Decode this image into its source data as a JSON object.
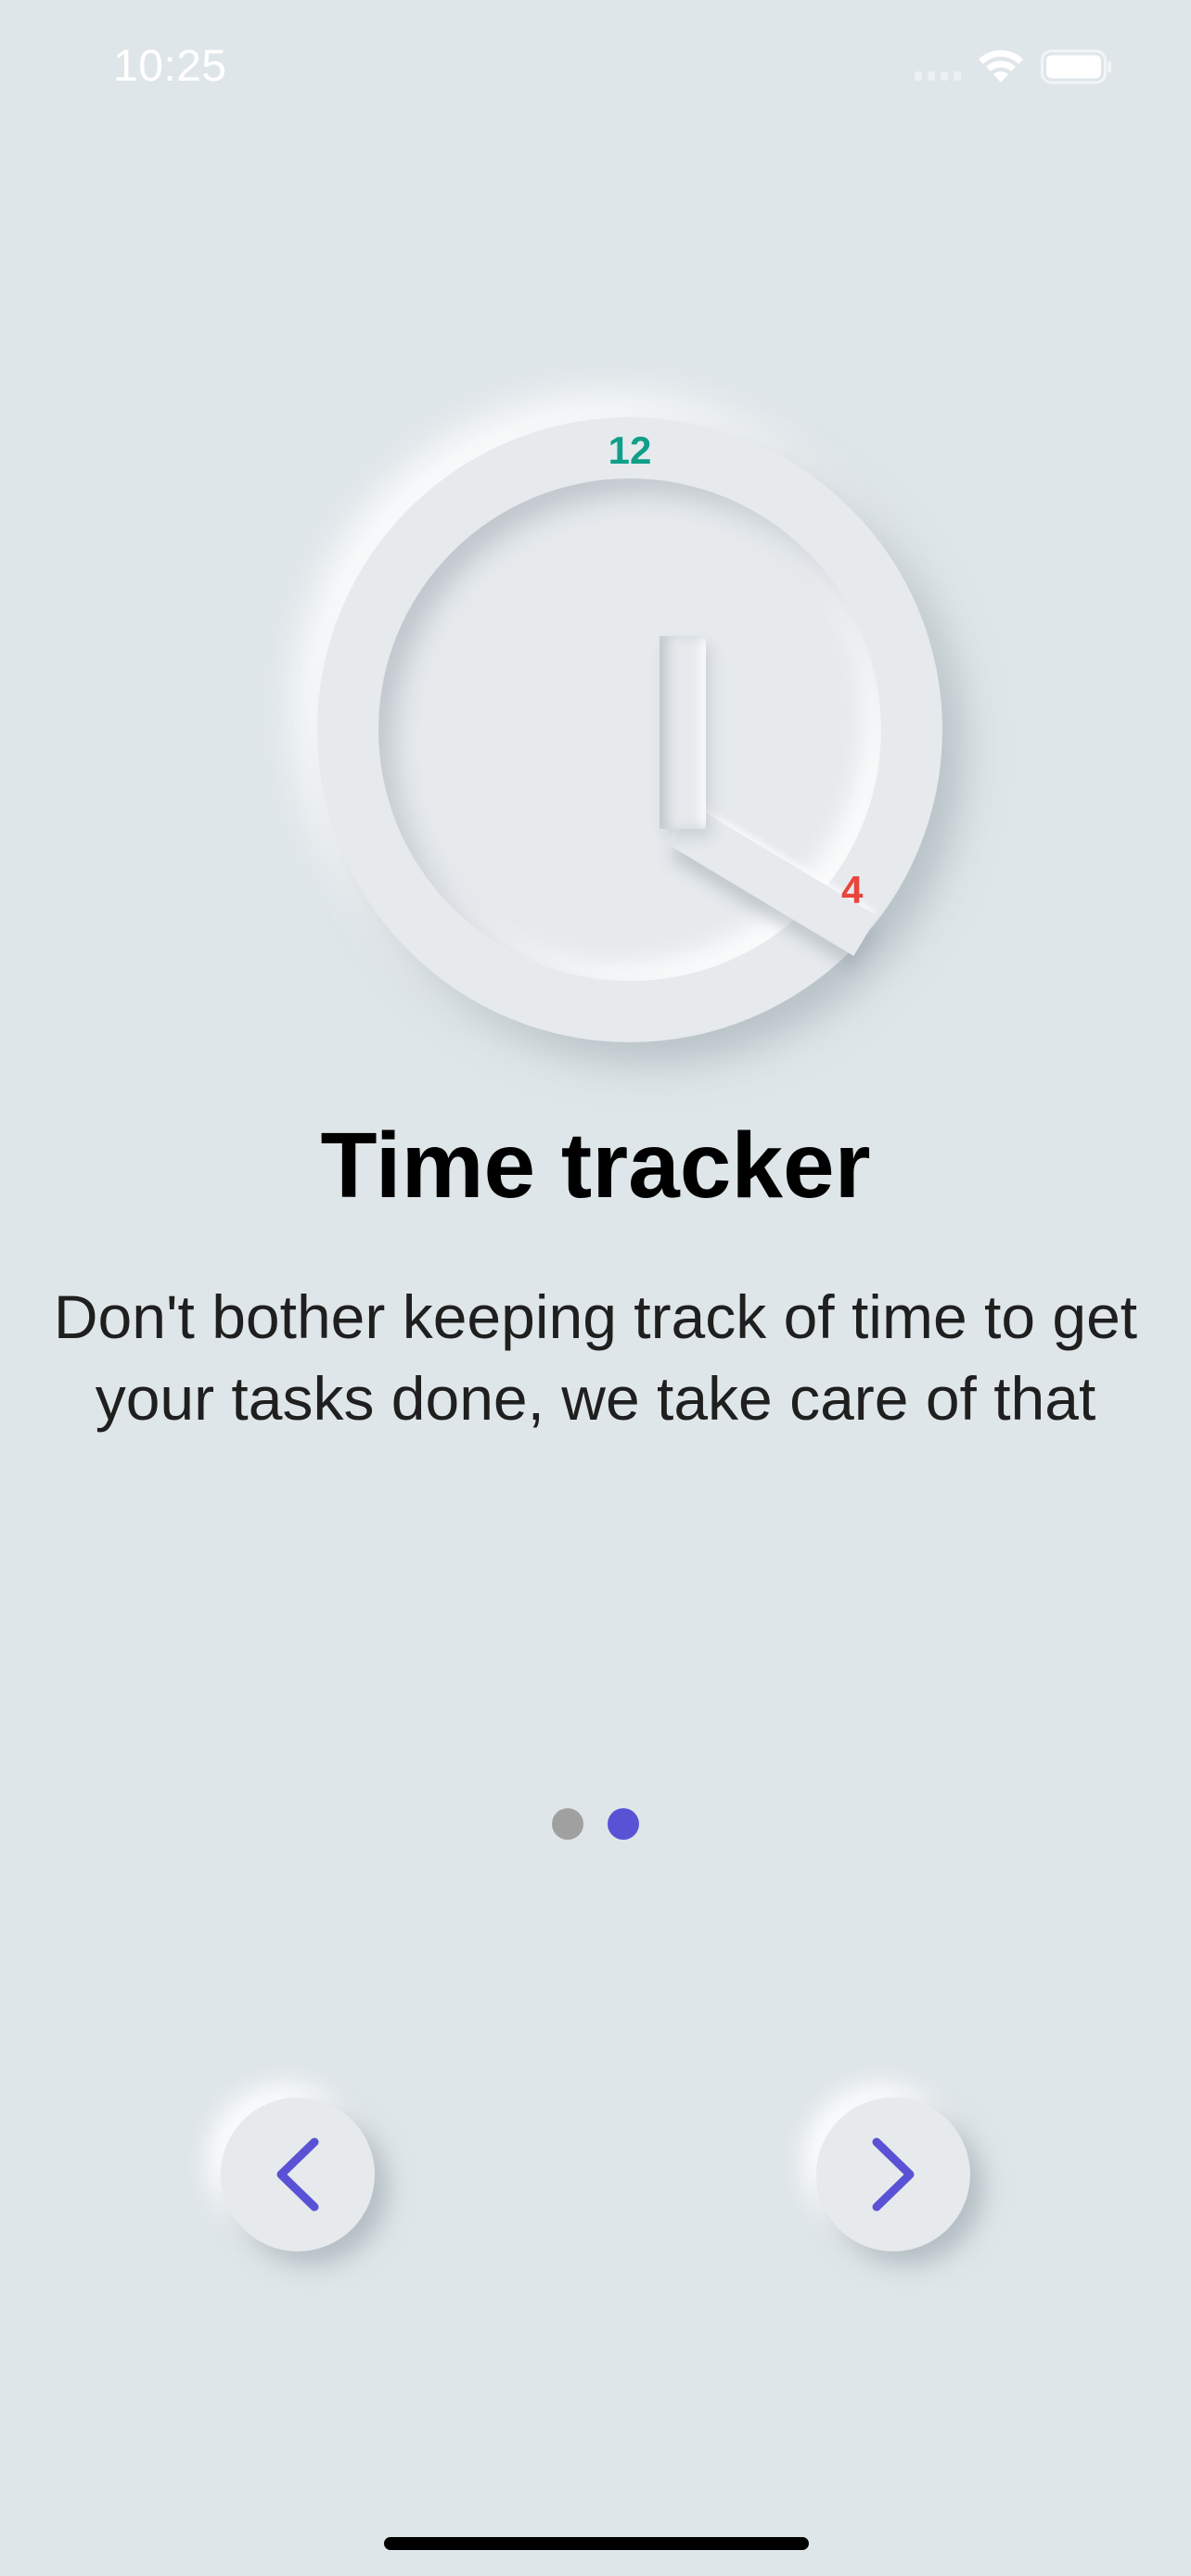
{
  "status_bar": {
    "time": "10:25"
  },
  "clock": {
    "number_top": "12",
    "number_side": "4",
    "color_top": "#0f9e8a",
    "color_side": "#e8453c"
  },
  "onboarding": {
    "title": "Time tracker",
    "description": "Don't bother keeping track of time to get your tasks done, we take care of that"
  },
  "pager": {
    "total_pages": 2,
    "current_page": 2
  },
  "navigation": {
    "prev_icon": "chevron-left-icon",
    "next_icon": "chevron-right-icon",
    "accent_color": "#5a52d5"
  }
}
